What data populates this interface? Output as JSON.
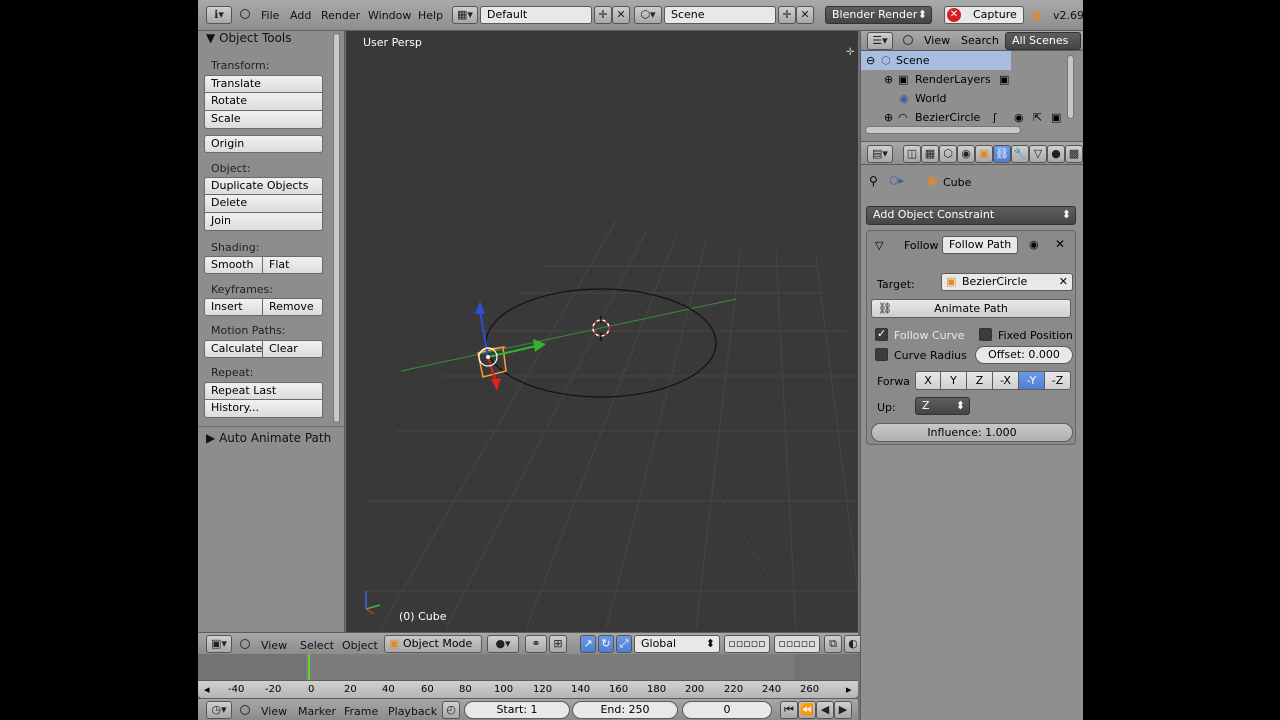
{
  "header": {
    "menus": [
      "File",
      "Add",
      "Render",
      "Window",
      "Help"
    ],
    "layout": "Default",
    "scene": "Scene",
    "engine": "Blender Render",
    "capture_label": "Capture",
    "version": "v2.69"
  },
  "toolshelf": {
    "title": "Object Tools",
    "transform_label": "Transform:",
    "translate": "Translate",
    "rotate": "Rotate",
    "scale": "Scale",
    "origin": "Origin",
    "object_label": "Object:",
    "duplicate": "Duplicate Objects",
    "delete": "Delete",
    "join": "Join",
    "shading_label": "Shading:",
    "smooth": "Smooth",
    "flat": "Flat",
    "keyframes_label": "Keyframes:",
    "insert": "Insert",
    "remove": "Remove",
    "motion_label": "Motion Paths:",
    "calculate": "Calculate",
    "clear": "Clear",
    "repeat_label": "Repeat:",
    "repeat_last": "Repeat Last",
    "history": "History...",
    "auto_animate": "Auto Animate Path"
  },
  "viewport": {
    "view_name": "User Persp",
    "object_info": "(0) Cube"
  },
  "view3d_header": {
    "menus": [
      "View",
      "Select",
      "Object"
    ],
    "mode": "Object Mode",
    "orientation": "Global"
  },
  "timeline": {
    "ticks": [
      "-40",
      "-20",
      "0",
      "20",
      "40",
      "60",
      "80",
      "100",
      "120",
      "140",
      "160",
      "180",
      "200",
      "220",
      "240",
      "260"
    ],
    "current_frame": 0,
    "menus": [
      "View",
      "Marker",
      "Frame",
      "Playback"
    ],
    "start": "Start: 1",
    "end": "End: 250",
    "frame": "0"
  },
  "outliner": {
    "menus": [
      "View",
      "Search"
    ],
    "filter": "All Scenes",
    "items": [
      "Scene",
      "RenderLayers",
      "World",
      "BezierCircle"
    ]
  },
  "properties": {
    "breadcrumb_object": "Cube",
    "add_constraint": "Add Object Constraint",
    "constraint_name": "Follow",
    "constraint_type": "Follow Path",
    "target_label": "Target:",
    "target_value": "BezierCircle",
    "animate_path": "Animate Path",
    "follow_curve": "Follow Curve",
    "fixed_position": "Fixed Position",
    "curve_radius": "Curve Radius",
    "offset": "Offset: 0.000",
    "forward_label": "Forwa",
    "forward_axes": [
      "X",
      "Y",
      "Z",
      "-X",
      "-Y",
      "-Z"
    ],
    "forward_selected": "-Y",
    "up_label": "Up:",
    "up_value": "Z",
    "influence": "Influence: 1.000"
  },
  "colors": {
    "accent_blue": "#5680c2",
    "active_orange": "#ffa030",
    "capture_red": "#d32121"
  }
}
